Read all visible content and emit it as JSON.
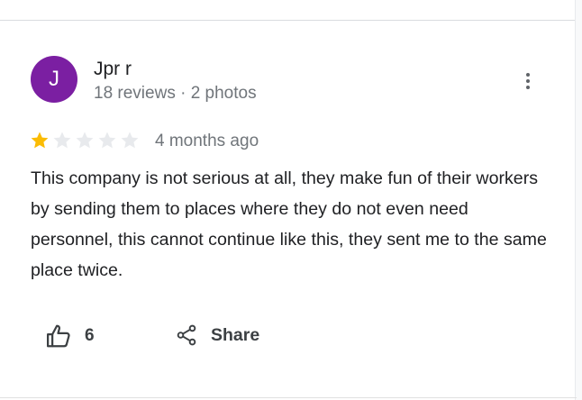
{
  "review": {
    "avatar_letter": "J",
    "avatar_color": "#7b1fa2",
    "reviewer_name": "Jpr r",
    "reviewer_meta": "18 reviews · 2 photos",
    "rating": 1,
    "rating_max": 5,
    "star_filled_color": "#fbbc04",
    "star_empty_color": "#e8eaed",
    "date": "4 months ago",
    "text": "This company is not serious at all, they make fun of their workers by sending them to places where they do not even need personnel, this cannot continue like this, they sent me to the same place twice."
  },
  "actions": {
    "like_icon": "thumbs-up-icon",
    "like_count": "6",
    "share_icon": "share-icon",
    "share_label": "Share",
    "more_icon": "more-vert-icon"
  }
}
